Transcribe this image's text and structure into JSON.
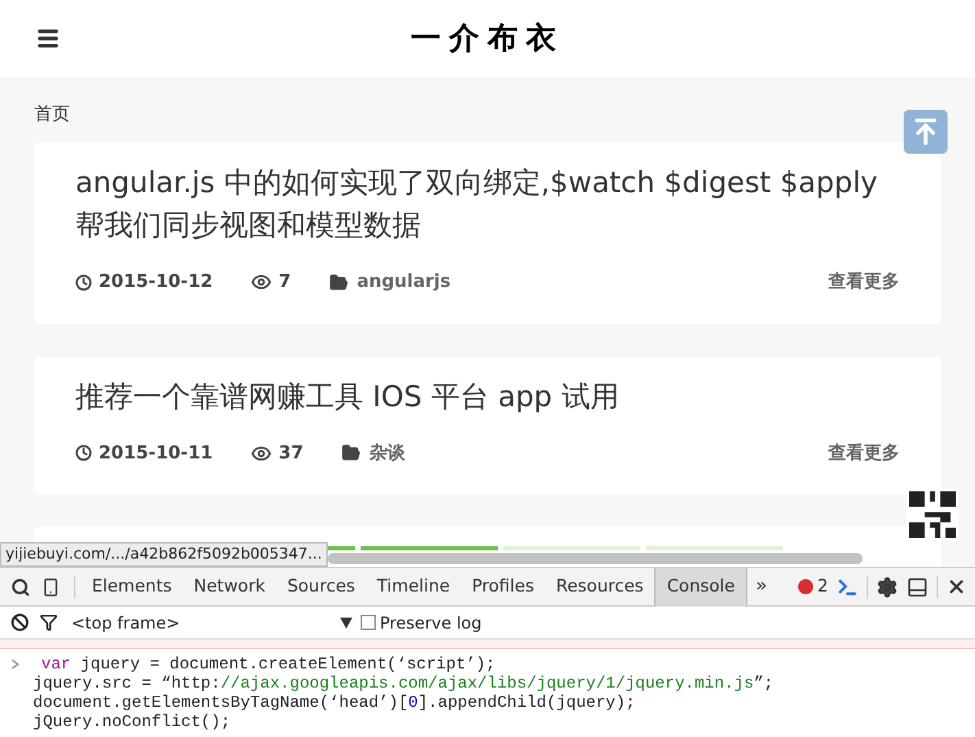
{
  "header": {
    "logo": "一介布衣"
  },
  "breadcrumb": "首页",
  "posts": [
    {
      "title": "angular.js 中的如何实现了双向绑定,$watch $digest $apply 帮我们同步视图和模型数据",
      "date": "2015-10-12",
      "views": "7",
      "category": "angularjs",
      "more": "查看更多"
    },
    {
      "title": "推荐一个靠谱网赚工具 IOS 平台 app 试用",
      "date": "2015-10-11",
      "views": "37",
      "category": "杂谈",
      "more": "查看更多"
    }
  ],
  "status_url": "yijiebuyi.com/.../a42b862f5092b005347...",
  "devtools": {
    "tabs": [
      {
        "label": "Elements",
        "selected": false
      },
      {
        "label": "Network",
        "selected": false
      },
      {
        "label": "Sources",
        "selected": false
      },
      {
        "label": "Timeline",
        "selected": false
      },
      {
        "label": "Profiles",
        "selected": false
      },
      {
        "label": "Resources",
        "selected": false
      },
      {
        "label": "Console",
        "selected": true
      }
    ],
    "overflow": "»",
    "error_count": "2",
    "frame_select": "<top frame>",
    "preserve_log": {
      "label": "Preserve log",
      "checked": false
    },
    "console_lines": [
      [
        {
          "kind": "keyword",
          "text": "var"
        },
        {
          "kind": "plain",
          "text": " jquery = document.createElement(‘script’);"
        }
      ],
      [
        {
          "kind": "plain",
          "text": "jquery.src = “http:"
        },
        {
          "kind": "string",
          "text": "//ajax.googleapis.com/ajax/libs/jquery/1/jquery.min.js"
        },
        {
          "kind": "plain",
          "text": "”;"
        }
      ],
      [
        {
          "kind": "plain",
          "text": "document.getElementsByTagName(‘head’)["
        },
        {
          "kind": "number",
          "text": "0"
        },
        {
          "kind": "plain",
          "text": "].appendChild(jquery);"
        }
      ],
      [
        {
          "kind": "plain",
          "text": "jQuery.noConflict();"
        }
      ]
    ]
  }
}
